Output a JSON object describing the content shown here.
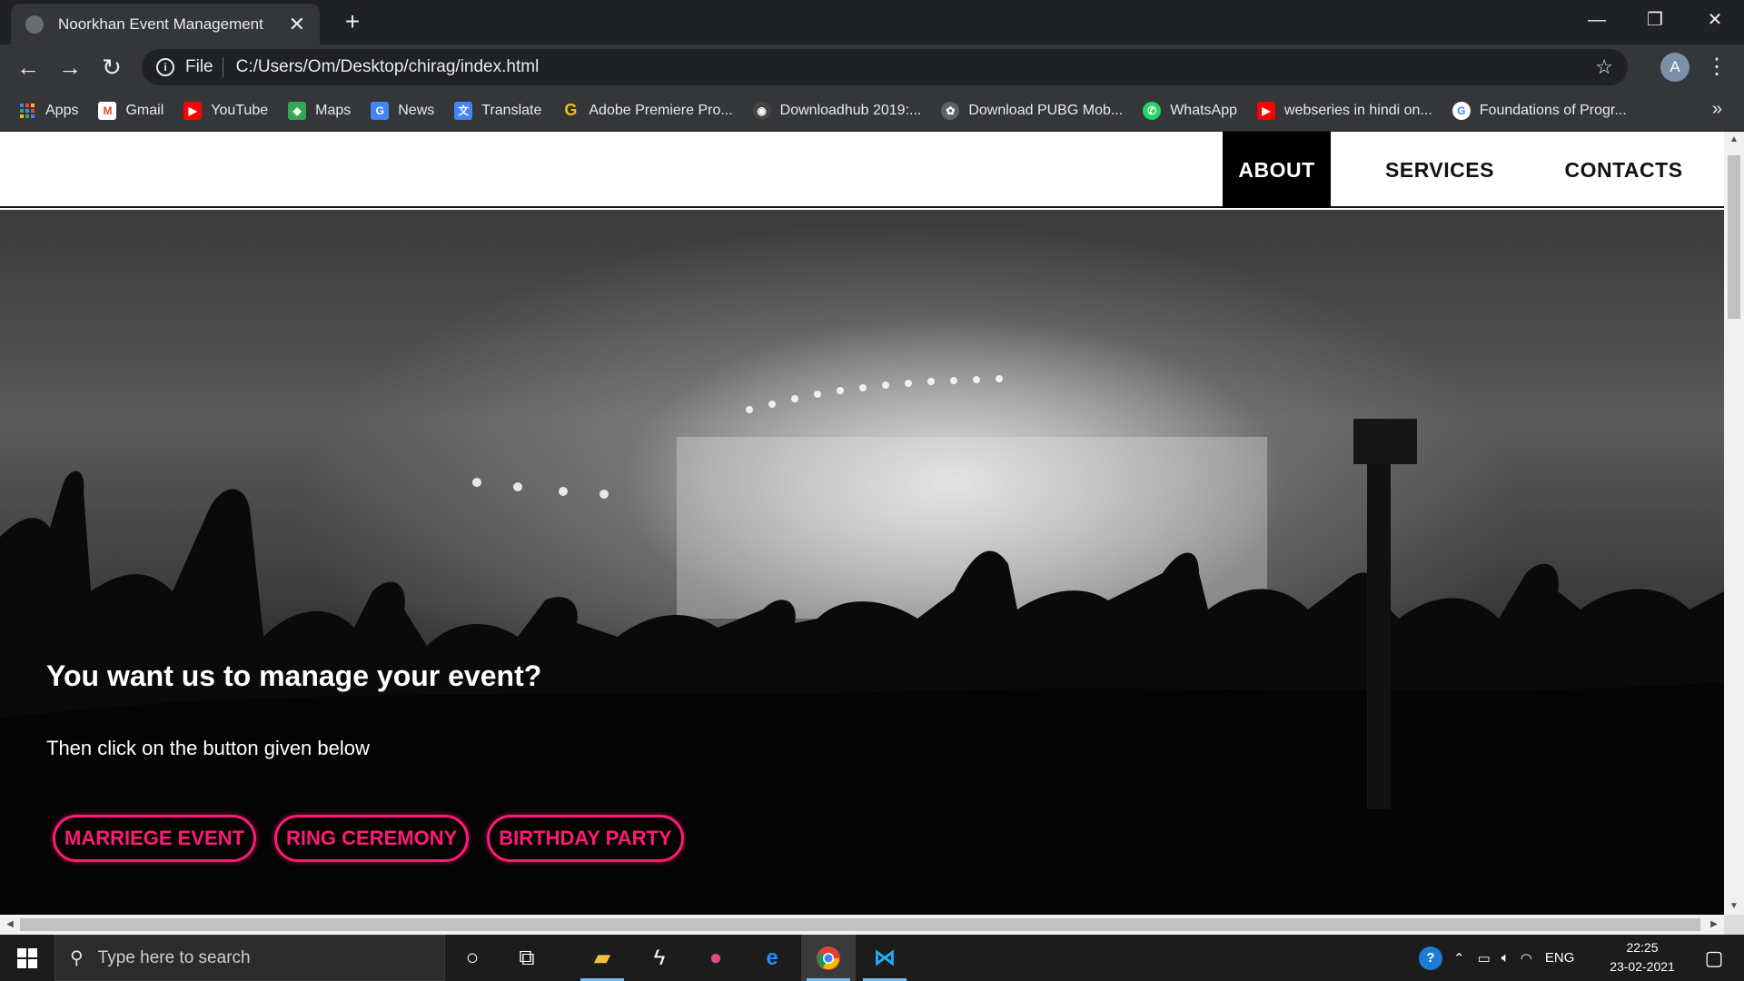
{
  "browser": {
    "tab_title": "Noorkhan Event Management",
    "tab_close": "✕",
    "new_tab": "+",
    "window_controls": {
      "minimize": "—",
      "restore": "❐",
      "close": "✕"
    },
    "address": {
      "scheme": "File",
      "url": "C:/Users/Om/Desktop/chirag/index.html"
    },
    "profile_initial": "A",
    "bookmarks": [
      {
        "label": "Apps",
        "icon": "apps-grid-icon",
        "color": "#4285f4"
      },
      {
        "label": "Gmail",
        "icon": "gmail-icon",
        "color": "#ea4335"
      },
      {
        "label": "YouTube",
        "icon": "youtube-icon",
        "color": "#ff0000"
      },
      {
        "label": "Maps",
        "icon": "maps-icon",
        "color": "#34a853"
      },
      {
        "label": "News",
        "icon": "news-icon",
        "color": "#4285f4"
      },
      {
        "label": "Translate",
        "icon": "translate-icon",
        "color": "#4285f4"
      },
      {
        "label": "Adobe Premiere Pro...",
        "icon": "google-g-icon",
        "color": "#fbbc05"
      },
      {
        "label": "Downloadhub 2019:...",
        "icon": "downloadhub-icon",
        "color": "#444444"
      },
      {
        "label": "Download PUBG Mob...",
        "icon": "pubg-icon",
        "color": "#5f6368"
      },
      {
        "label": "WhatsApp",
        "icon": "whatsapp-icon",
        "color": "#25d366"
      },
      {
        "label": "webseries in hindi on...",
        "icon": "youtube-icon",
        "color": "#ff0000"
      },
      {
        "label": "Foundations of Progr...",
        "icon": "google-g-icon",
        "color": "#ffffff"
      }
    ],
    "bookmarks_more": "»"
  },
  "site": {
    "nav": [
      {
        "label": "ABOUT",
        "active": true
      },
      {
        "label": "SERVICES",
        "active": false
      },
      {
        "label": "CONTACTS",
        "active": false
      }
    ],
    "hero": {
      "title": "You want us to manage your event?",
      "subtitle": "Then click on the button given below",
      "buttons": [
        "MARRIEGE EVENT",
        "RING CEREMONY",
        "BIRTHDAY PARTY"
      ],
      "accent_color": "#ff1a75"
    }
  },
  "taskbar": {
    "search_placeholder": "Type here to search",
    "language": "ENG",
    "time": "22:25",
    "date": "23-02-2021"
  }
}
